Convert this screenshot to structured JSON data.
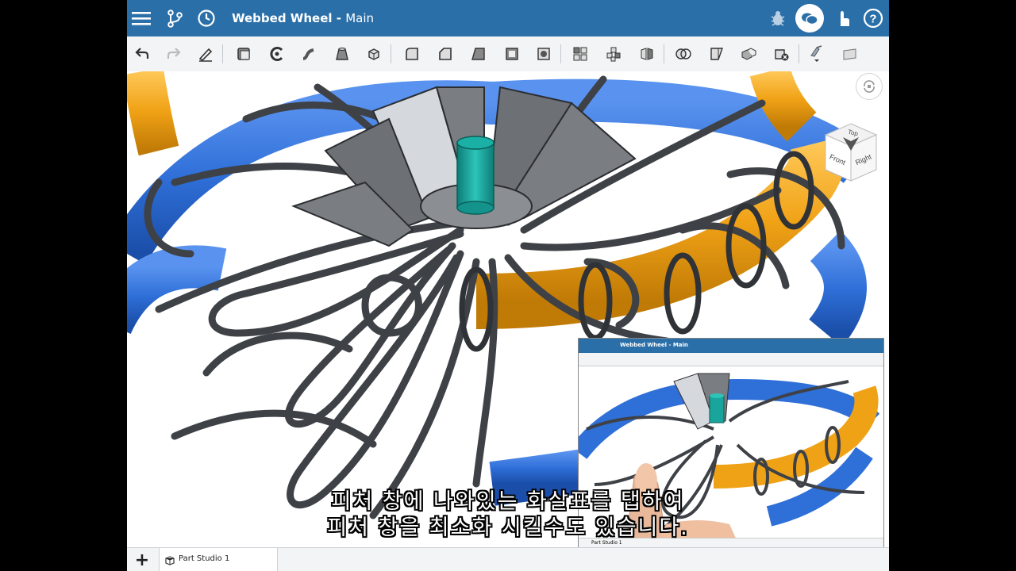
{
  "app": {
    "document_title": "Webbed Wheel",
    "title_separator": " - ",
    "branch": "Main"
  },
  "titlebar": {
    "left_icons": [
      "menu-icon",
      "branch-icon",
      "history-icon"
    ],
    "right_icons": [
      "bug-icon",
      "comments-icon",
      "touch-mode-icon",
      "help-icon"
    ]
  },
  "toolbar": {
    "tools": [
      "undo",
      "redo",
      "sketch",
      "extrude",
      "revolve",
      "sweep",
      "loft",
      "thicken",
      "fillet",
      "chamfer",
      "draft",
      "shell",
      "hole",
      "pattern",
      "mirror",
      "split",
      "boolean",
      "delete-face",
      "transform",
      "replace-face",
      "delete-part",
      "view-options",
      "display-mode"
    ]
  },
  "viewcube": {
    "top": "Top",
    "front": "Front",
    "right": "Right"
  },
  "inset": {
    "title": "Webbed Wheel - Main",
    "tab": "Part Studio 1"
  },
  "subtitles": {
    "line1": "피처 창에 나와있는 화살표를 탭하여",
    "line2": "피처 창을 최소화 시킬수도 있습니다."
  },
  "tabbar": {
    "add_label": "+",
    "tabs": [
      {
        "label": "Part Studio 1"
      }
    ]
  },
  "colors": {
    "header": "#2a6fa8",
    "toolbar": "#f3f4f5",
    "model_blue": "#2f6fd8",
    "model_orange": "#f0a216",
    "model_teal": "#19a59c",
    "model_gray": "#4a4d52"
  }
}
